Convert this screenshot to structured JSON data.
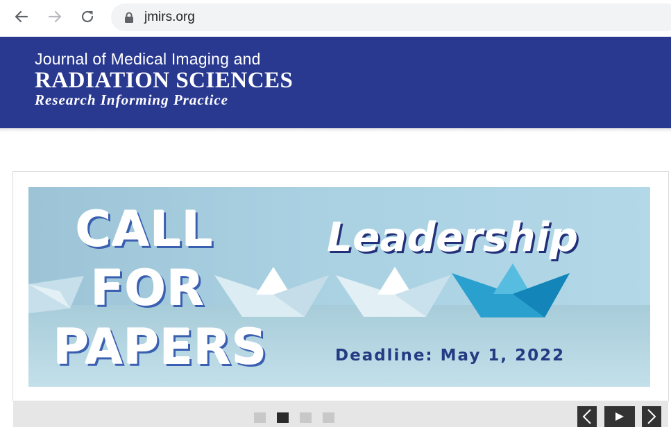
{
  "browser": {
    "url": "jmirs.org"
  },
  "header": {
    "title_line1": "Journal of Medical Imaging and",
    "title_line2": "RADIATION SCIENCES",
    "tagline": "Research Informing Practice",
    "background_color": "#2a3990"
  },
  "banner": {
    "heading_line1": "CALL",
    "heading_line2": "FOR",
    "heading_line3": "PAPERS",
    "topic": "Leadership",
    "deadline": "Deadline: May 1, 2022"
  },
  "carousel": {
    "slide_count": 4,
    "active_slide": 2,
    "controls": {
      "prev_icon": "chevron-left-icon",
      "play_icon": "play-icon",
      "next_icon": "chevron-right-icon"
    }
  }
}
